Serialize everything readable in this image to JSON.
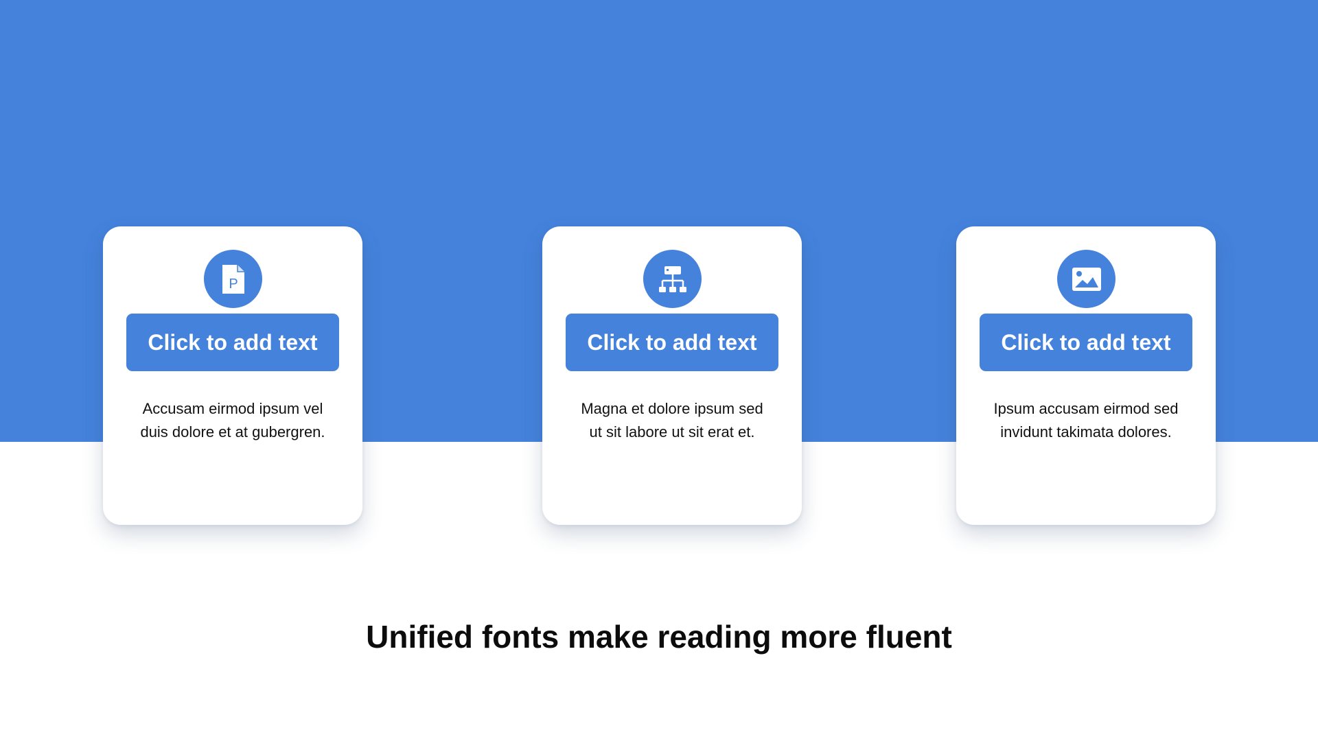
{
  "colors": {
    "accent": "#4482dc",
    "card_background": "#ffffff",
    "text": "#111111"
  },
  "cards": [
    {
      "icon": "document-p-icon",
      "button_label": "Click to add text",
      "description": "Accusam eirmod ipsum vel duis dolore et at gubergren."
    },
    {
      "icon": "org-chart-icon",
      "button_label": "Click to add text",
      "description": "Magna et dolore ipsum sed ut sit labore ut sit erat et."
    },
    {
      "icon": "image-icon",
      "button_label": "Click to add text",
      "description": "Ipsum accusam eirmod sed invidunt takimata dolores."
    }
  ],
  "title": "Unified fonts make reading more fluent"
}
